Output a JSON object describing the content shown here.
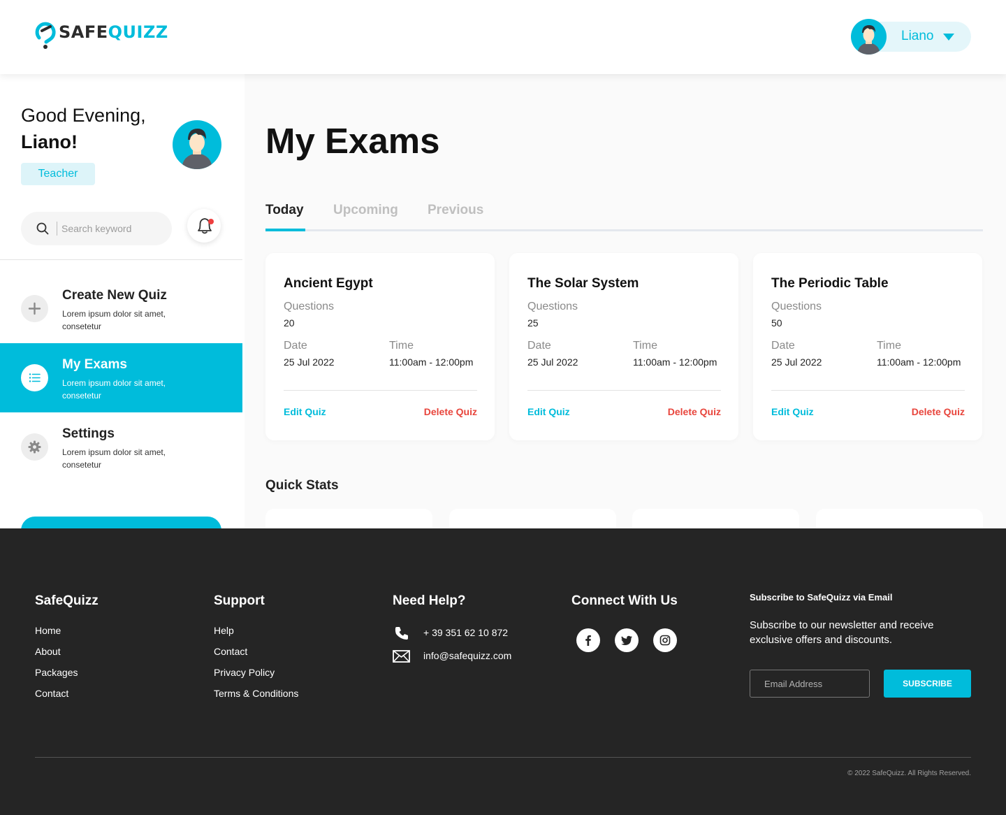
{
  "brand": {
    "logo_part1": "SAFE",
    "logo_part2": "QUIZZ",
    "accent_color": "#00bcdb",
    "danger_color": "#e8453c"
  },
  "header": {
    "user_name": "Liano"
  },
  "sidebar": {
    "greeting": "Good Evening,",
    "name": "Liano!",
    "role": "Teacher",
    "search_placeholder": "Search keyword",
    "menu": [
      {
        "title": "Create New Quiz",
        "desc": "Lorem ipsum dolor sit amet, consetetur",
        "icon": "plus-icon",
        "active": false
      },
      {
        "title": "My Exams",
        "desc": "Lorem ipsum dolor sit amet, consetetur",
        "icon": "list-icon",
        "active": true
      },
      {
        "title": "Settings",
        "desc": "Lorem ipsum dolor sit amet, consetetur",
        "icon": "gear-icon",
        "active": false
      }
    ]
  },
  "main": {
    "title": "My Exams",
    "tabs": [
      "Today",
      "Upcoming",
      "Previous"
    ],
    "active_tab": "Today",
    "question_label": "Questions",
    "date_label": "Date",
    "time_label": "Time",
    "edit_label": "Edit Quiz",
    "delete_label": "Delete Quiz",
    "exams": [
      {
        "title": "Ancient Egypt",
        "questions": "20",
        "date": "25 Jul 2022",
        "time": "11:00am - 12:00pm"
      },
      {
        "title": "The Solar System",
        "questions": "25",
        "date": "25 Jul 2022",
        "time": "11:00am - 12:00pm"
      },
      {
        "title": "The Periodic Table",
        "questions": "50",
        "date": "25 Jul 2022",
        "time": "11:00am - 12:00pm"
      }
    ],
    "quick_stats_title": "Quick Stats"
  },
  "footer": {
    "col1": {
      "title": "SafeQuizz",
      "links": [
        "Home",
        "About",
        "Packages",
        "Contact"
      ]
    },
    "col2": {
      "title": "Support",
      "links": [
        "Help",
        "Contact",
        "Privacy Policy",
        "Terms & Conditions"
      ]
    },
    "col3": {
      "title": "Need Help?",
      "phone": "+ 39 351 62 10 872",
      "email": "info@safequizz.com"
    },
    "col4": {
      "title": "Connect With Us",
      "socials": [
        "facebook-icon",
        "twitter-icon",
        "instagram-icon"
      ]
    },
    "subscribe": {
      "title": "Subscribe to SafeQuizz via Email",
      "text": "Subscribe to our newsletter and receive exclusive offers and discounts.",
      "placeholder": "Email Address",
      "button": "SUBSCRIBE"
    },
    "copyright": "© 2022 SafeQuizz. All Rights Reserved."
  }
}
